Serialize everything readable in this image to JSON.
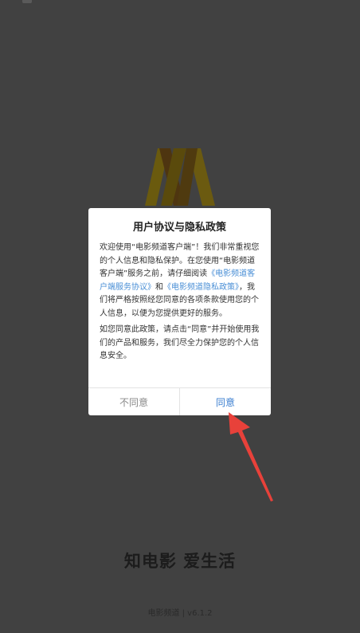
{
  "splash": {
    "slogan": "知电影 爱生活",
    "version": "电影频道 | v6.1.2"
  },
  "dialog": {
    "title": "用户协议与隐私政策",
    "para1_a": "欢迎使用“电影频道客户端”！我们非常重视您的个人信息和隐私保护。在您使用“电影频道客户端”服务之前，请仔细阅读",
    "link_service": "《电影频道客户端服务协议》",
    "para1_and": "和",
    "link_privacy": "《电影频道隐私政策》",
    "para1_b": "，我们将严格按照经您同意的各项条款使用您的个人信息，以便为您提供更好的服务。",
    "para2": "如您同意此政策，请点击“同意”并开始使用我们的产品和服务，我们尽全力保护您的个人信息安全。",
    "disagree_label": "不同意",
    "agree_label": "同意"
  },
  "colors": {
    "background": "#414141",
    "link": "#4a8fd6",
    "agree": "#3c7fd0",
    "arrow": "#e8413a",
    "logo": "#6b5a10"
  }
}
